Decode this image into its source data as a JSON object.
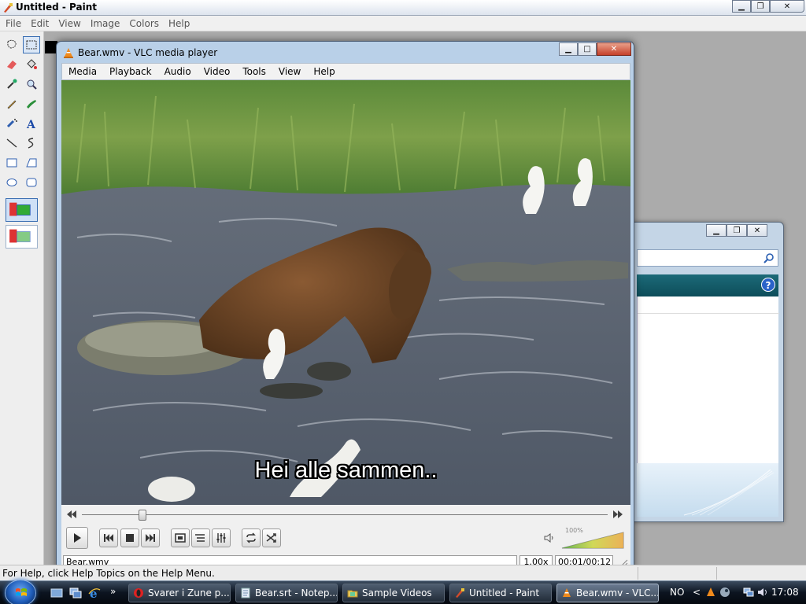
{
  "paint": {
    "title": "Untitled - Paint",
    "menu": [
      "File",
      "Edit",
      "View",
      "Image",
      "Colors",
      "Help"
    ],
    "status_text": "For Help, click Help Topics on the Help Menu."
  },
  "vlc": {
    "title": "Bear.wmv - VLC media player",
    "menu": [
      "Media",
      "Playback",
      "Audio",
      "Video",
      "Tools",
      "View",
      "Help"
    ],
    "subtitle": "Hei alle sammen..",
    "seek_position": 0.115,
    "volume_label": "100%",
    "volume_level": 1.0,
    "status": {
      "filename": "Bear.wmv",
      "rate": "1.00x",
      "time": "00:01/00:12"
    }
  },
  "taskbar": {
    "tasks": [
      {
        "label": "Svarer i Zune p...",
        "icon": "opera-icon",
        "active": false
      },
      {
        "label": "Bear.srt - Notep...",
        "icon": "notepad-icon",
        "active": false
      },
      {
        "label": "Sample Videos",
        "icon": "folder-icon",
        "active": false
      },
      {
        "label": "Untitled - Paint",
        "icon": "paint-icon",
        "active": false
      },
      {
        "label": "Bear.wmv - VLC...",
        "icon": "vlc-icon",
        "active": true
      }
    ],
    "language": "NO",
    "clock": "17:08"
  },
  "colors": {
    "vlc_frame": "#b9d0e8",
    "taskbar": "#0c1420",
    "teal_band": "#1c6a78"
  }
}
